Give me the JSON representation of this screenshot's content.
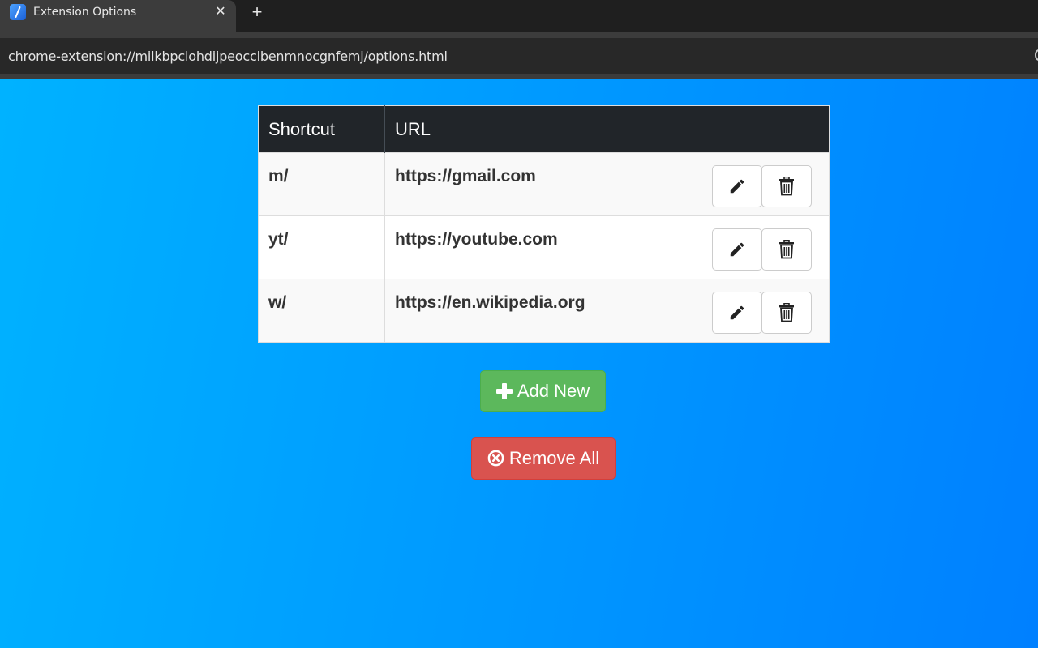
{
  "browser": {
    "tab_title": "Extension Options",
    "tab_close_glyph": "✕",
    "new_tab_glyph": "+",
    "url": "chrome-extension://milkbpclohdijpeocclbenmnocgnfemj/options.html"
  },
  "table": {
    "headers": {
      "shortcut": "Shortcut",
      "url": "URL",
      "actions": ""
    },
    "rows": [
      {
        "shortcut": "m/",
        "url": "https://gmail.com"
      },
      {
        "shortcut": "yt/",
        "url": "https://youtube.com"
      },
      {
        "shortcut": "w/",
        "url": "https://en.wikipedia.org"
      }
    ],
    "edit_icon": "pencil-icon",
    "delete_icon": "trash-icon"
  },
  "actions": {
    "add_label": "Add New",
    "add_icon": "plus-icon",
    "remove_label": "Remove All",
    "remove_icon": "times-circle-icon"
  },
  "colors": {
    "add_button": "#5cb85c",
    "remove_button": "#d9534f",
    "table_header": "#212529",
    "page_gradient_start": "#00b2ff",
    "page_gradient_end": "#0080ff"
  }
}
